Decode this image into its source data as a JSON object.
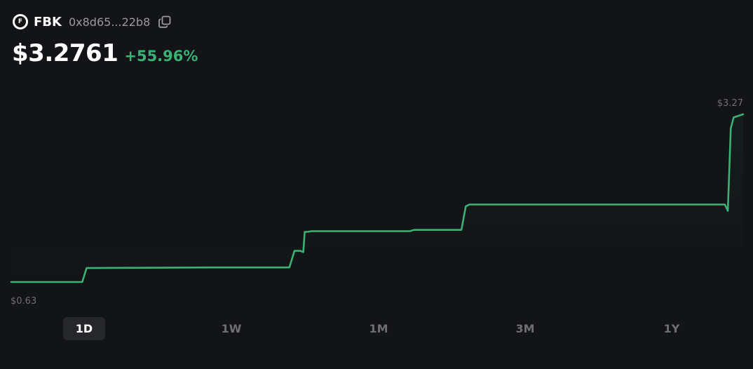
{
  "token": {
    "logo_letter": "F",
    "symbol": "FBK",
    "address": "0x8d65...22b8"
  },
  "price": {
    "value": "$3.2761",
    "change": "+55.96%"
  },
  "colors": {
    "background": "#131417",
    "line": "#3bb273",
    "change": "#3bb273",
    "muted_text": "#6e6f75",
    "active_button_bg": "#26272b"
  },
  "icons": {
    "copy": "copy-icon"
  },
  "chart_data": {
    "type": "line",
    "max_label": "$3.27",
    "min_label": "$0.63",
    "ylim": [
      0.63,
      3.28
    ],
    "x": [
      0,
      0.097,
      0.103,
      0.28,
      0.38,
      0.387,
      0.395,
      0.399,
      0.401,
      0.405,
      0.41,
      0.545,
      0.55,
      0.615,
      0.621,
      0.626,
      0.975,
      0.979,
      0.983,
      0.987,
      1.0
    ],
    "values": [
      0.63,
      0.63,
      0.85,
      0.86,
      0.86,
      1.12,
      1.12,
      1.1,
      1.42,
      1.42,
      1.43,
      1.43,
      1.45,
      1.45,
      1.82,
      1.85,
      1.85,
      1.75,
      3.05,
      3.22,
      3.27
    ],
    "grid": false
  },
  "time_ranges": [
    {
      "label": "1D",
      "active": true
    },
    {
      "label": "1W",
      "active": false
    },
    {
      "label": "1M",
      "active": false
    },
    {
      "label": "3M",
      "active": false
    },
    {
      "label": "1Y",
      "active": false
    }
  ]
}
